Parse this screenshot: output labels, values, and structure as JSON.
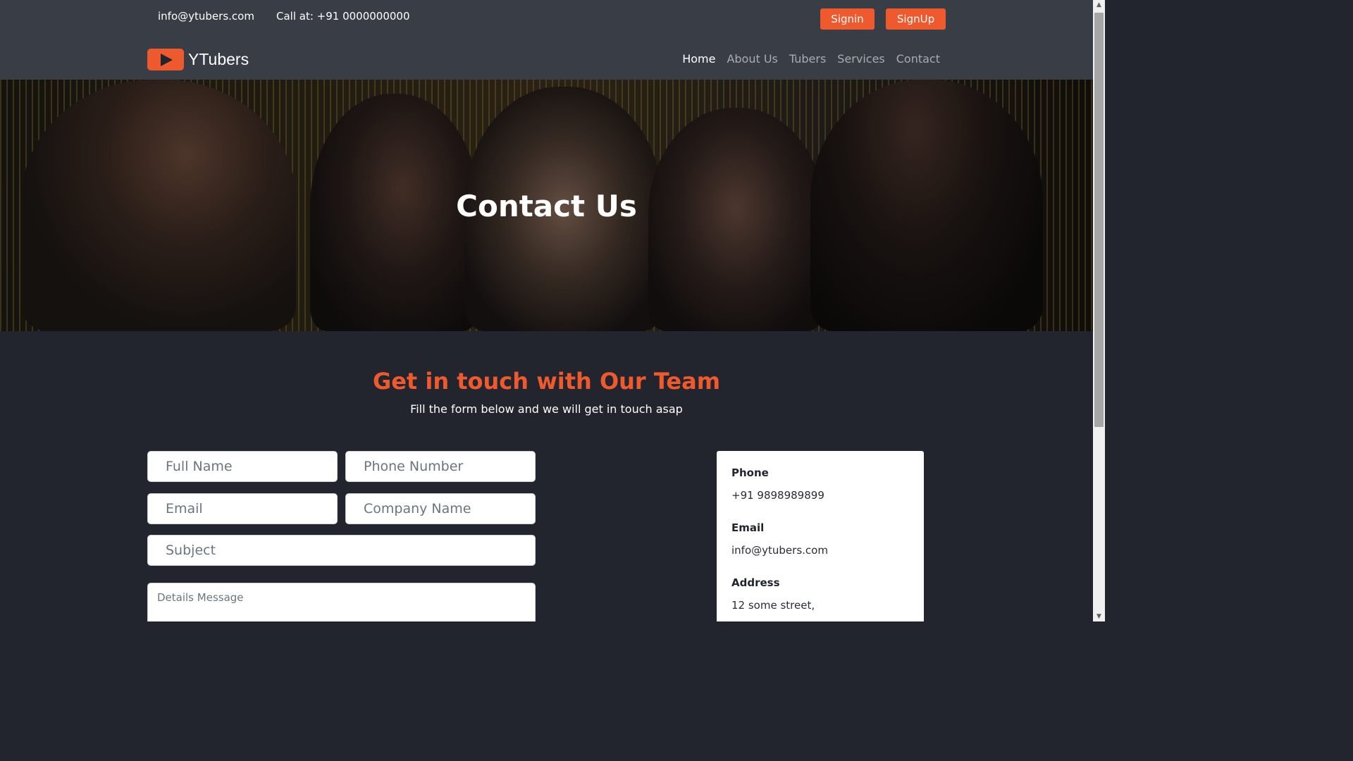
{
  "topbar": {
    "email": "info@ytubers.com",
    "phone": "Call at: +91 0000000000",
    "signin_label": "Signin",
    "signup_label": "SignUp"
  },
  "nav": {
    "brand": "YTubers",
    "links": [
      "Home",
      "About Us",
      "Tubers",
      "Services",
      "Contact"
    ],
    "active": "Home"
  },
  "hero": {
    "title": "Contact Us"
  },
  "section": {
    "title": "Get in touch with Our Team",
    "subtitle": "Fill the form below and we will get in touch asap"
  },
  "form": {
    "full_name_placeholder": "Full Name",
    "phone_placeholder": "Phone Number",
    "email_placeholder": "Email",
    "company_placeholder": "Company Name",
    "subject_placeholder": "Subject",
    "message_placeholder": "Details Message"
  },
  "contact_info": {
    "phone_label": "Phone",
    "phone_value": "+91 9898989899",
    "email_label": "Email",
    "email_value": "info@ytubers.com",
    "address_label": "Address",
    "address_value": "12 some street,"
  },
  "colors": {
    "accent": "#ee5a2e",
    "topbar_bg": "#393e46",
    "page_bg": "#22252d"
  },
  "icons": {
    "logo": "play-icon",
    "scroll_up": "arrow-up-icon",
    "scroll_down": "arrow-down-icon"
  }
}
